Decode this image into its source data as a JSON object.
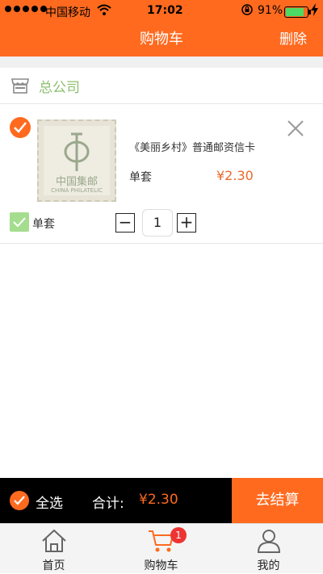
{
  "status_bar": {
    "carrier": "中国移动",
    "time": "17:02",
    "battery_percent": "91%",
    "battery_level": 0.91
  },
  "navbar": {
    "title": "购物车",
    "delete_label": "删除"
  },
  "store": {
    "name": "总公司",
    "icon": "store-icon"
  },
  "item": {
    "name": "《美丽乡村》普通邮资信卡",
    "spec": "单套",
    "price": "¥2.30",
    "sku_label": "单套",
    "quantity": "1",
    "thumbnail_text": "中国集邮",
    "thumbnail_subtext": "CHINA PHILATELIC",
    "checked": true
  },
  "checkout": {
    "select_all_label": "全选",
    "total_label": "合计:",
    "total_value": "¥2.30",
    "checkout_label": "去结算"
  },
  "tabs": [
    {
      "label": "首页",
      "icon": "home-icon"
    },
    {
      "label": "购物车",
      "icon": "cart-icon",
      "badge": "1"
    },
    {
      "label": "我的",
      "icon": "user-icon"
    }
  ],
  "colors": {
    "accent": "#ff6a1f",
    "green": "#8dc06e",
    "price": "#e86a2d"
  }
}
